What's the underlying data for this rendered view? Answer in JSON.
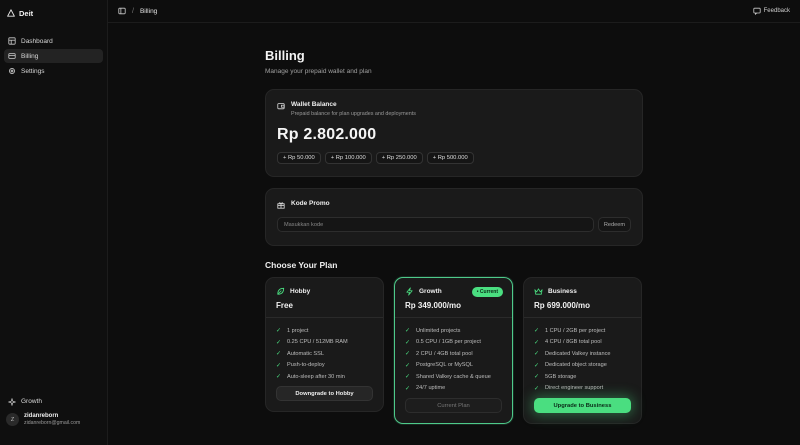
{
  "brand": {
    "name": "Deit"
  },
  "sidebar": {
    "items": [
      {
        "label": "Dashboard",
        "icon": "dashboard-icon"
      },
      {
        "label": "Billing",
        "icon": "wallet-icon"
      },
      {
        "label": "Settings",
        "icon": "gear-icon"
      }
    ],
    "plan_link": "Growth",
    "user": {
      "initial": "Z",
      "name": "zidanreborn",
      "email": "zidanreborn@gmail.com"
    }
  },
  "topbar": {
    "separator": "/",
    "breadcrumb": "Billing",
    "feedback": "Feedback"
  },
  "page": {
    "title": "Billing",
    "subtitle": "Manage your prepaid wallet and plan"
  },
  "wallet": {
    "title": "Wallet Balance",
    "description": "Prepaid balance for plan upgrades and deployments",
    "balance": "Rp 2.802.000",
    "topups": [
      "+ Rp 50.000",
      "+ Rp 100.000",
      "+ Rp 250.000",
      "+ Rp 500.000"
    ]
  },
  "promo": {
    "title": "Kode Promo",
    "placeholder": "Masukkan kode",
    "redeem": "Redeem"
  },
  "plans_section": {
    "title": "Choose Your Plan"
  },
  "plans": [
    {
      "name": "Hobby",
      "price": "Free",
      "features": [
        "1 project",
        "0.25 CPU / 512MB RAM",
        "Automatic SSL",
        "Push-to-deploy",
        "Auto-sleep after 30 min"
      ],
      "button": "Downgrade to Hobby"
    },
    {
      "name": "Growth",
      "price": "Rp 349.000/mo",
      "badge": "• Current",
      "features": [
        "Unlimited projects",
        "0.5 CPU / 1GB per project",
        "2 CPU / 4GB total pool",
        "PostgreSQL or MySQL",
        "Shared Valkey cache & queue",
        "24/7 uptime"
      ],
      "button": "Current Plan"
    },
    {
      "name": "Business",
      "price": "Rp 699.000/mo",
      "features": [
        "1 CPU / 2GB per project",
        "4 CPU / 8GB total pool",
        "Dedicated Valkey instance",
        "Dedicated object storage",
        "5GB storage",
        "Direct engineer support"
      ],
      "button": "Upgrade to Business"
    }
  ],
  "colors": {
    "accent": "#4ade80",
    "background": "#0d0d0d",
    "card": "#1a1a1a"
  }
}
